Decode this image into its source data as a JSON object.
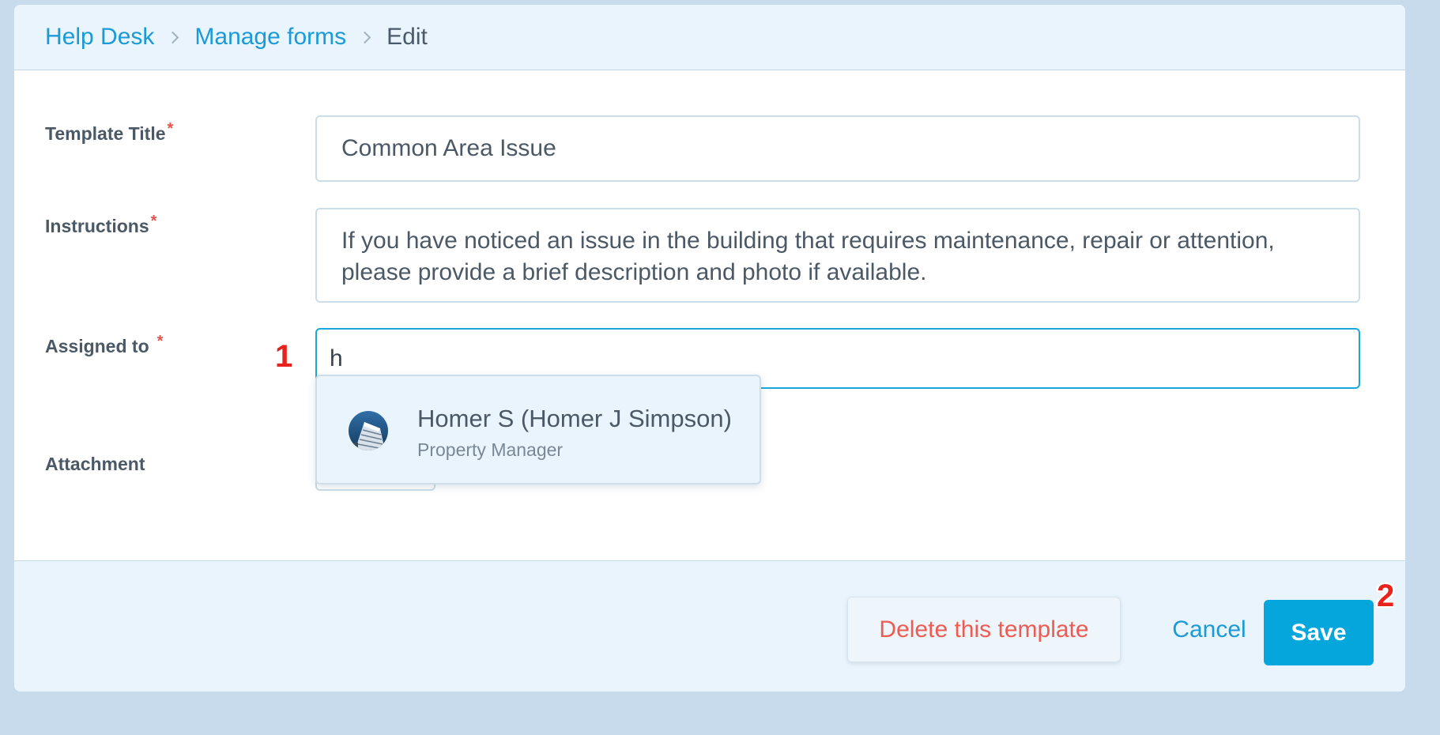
{
  "breadcrumb": {
    "items": [
      "Help Desk",
      "Manage forms"
    ],
    "current": "Edit"
  },
  "form": {
    "template_title": {
      "label": "Template Title",
      "required_mark": "*",
      "value": "Common Area Issue"
    },
    "instructions": {
      "label": "Instructions",
      "required_mark": "*",
      "value": "If you have noticed an issue in the building that requires maintenance, repair or attention, please provide a brief description and photo if available."
    },
    "assigned_to": {
      "label": "Assigned to",
      "required_mark": "*",
      "value": "h"
    },
    "attachment": {
      "label": "Attachment"
    }
  },
  "suggestions": [
    {
      "name": "Homer S (Homer J Simpson)",
      "role": "Property Manager",
      "icon": "building-avatar"
    }
  ],
  "footer": {
    "delete_label": "Delete this template",
    "cancel_label": "Cancel",
    "save_label": "Save"
  },
  "annotations": {
    "step1": "1",
    "step2": "2"
  },
  "colors": {
    "accent": "#04a6dc",
    "link": "#1a9ad6",
    "danger": "#ee5b52",
    "required": "#e5524b",
    "annotation": "#e8231e",
    "page_bg": "#c7dbec"
  }
}
